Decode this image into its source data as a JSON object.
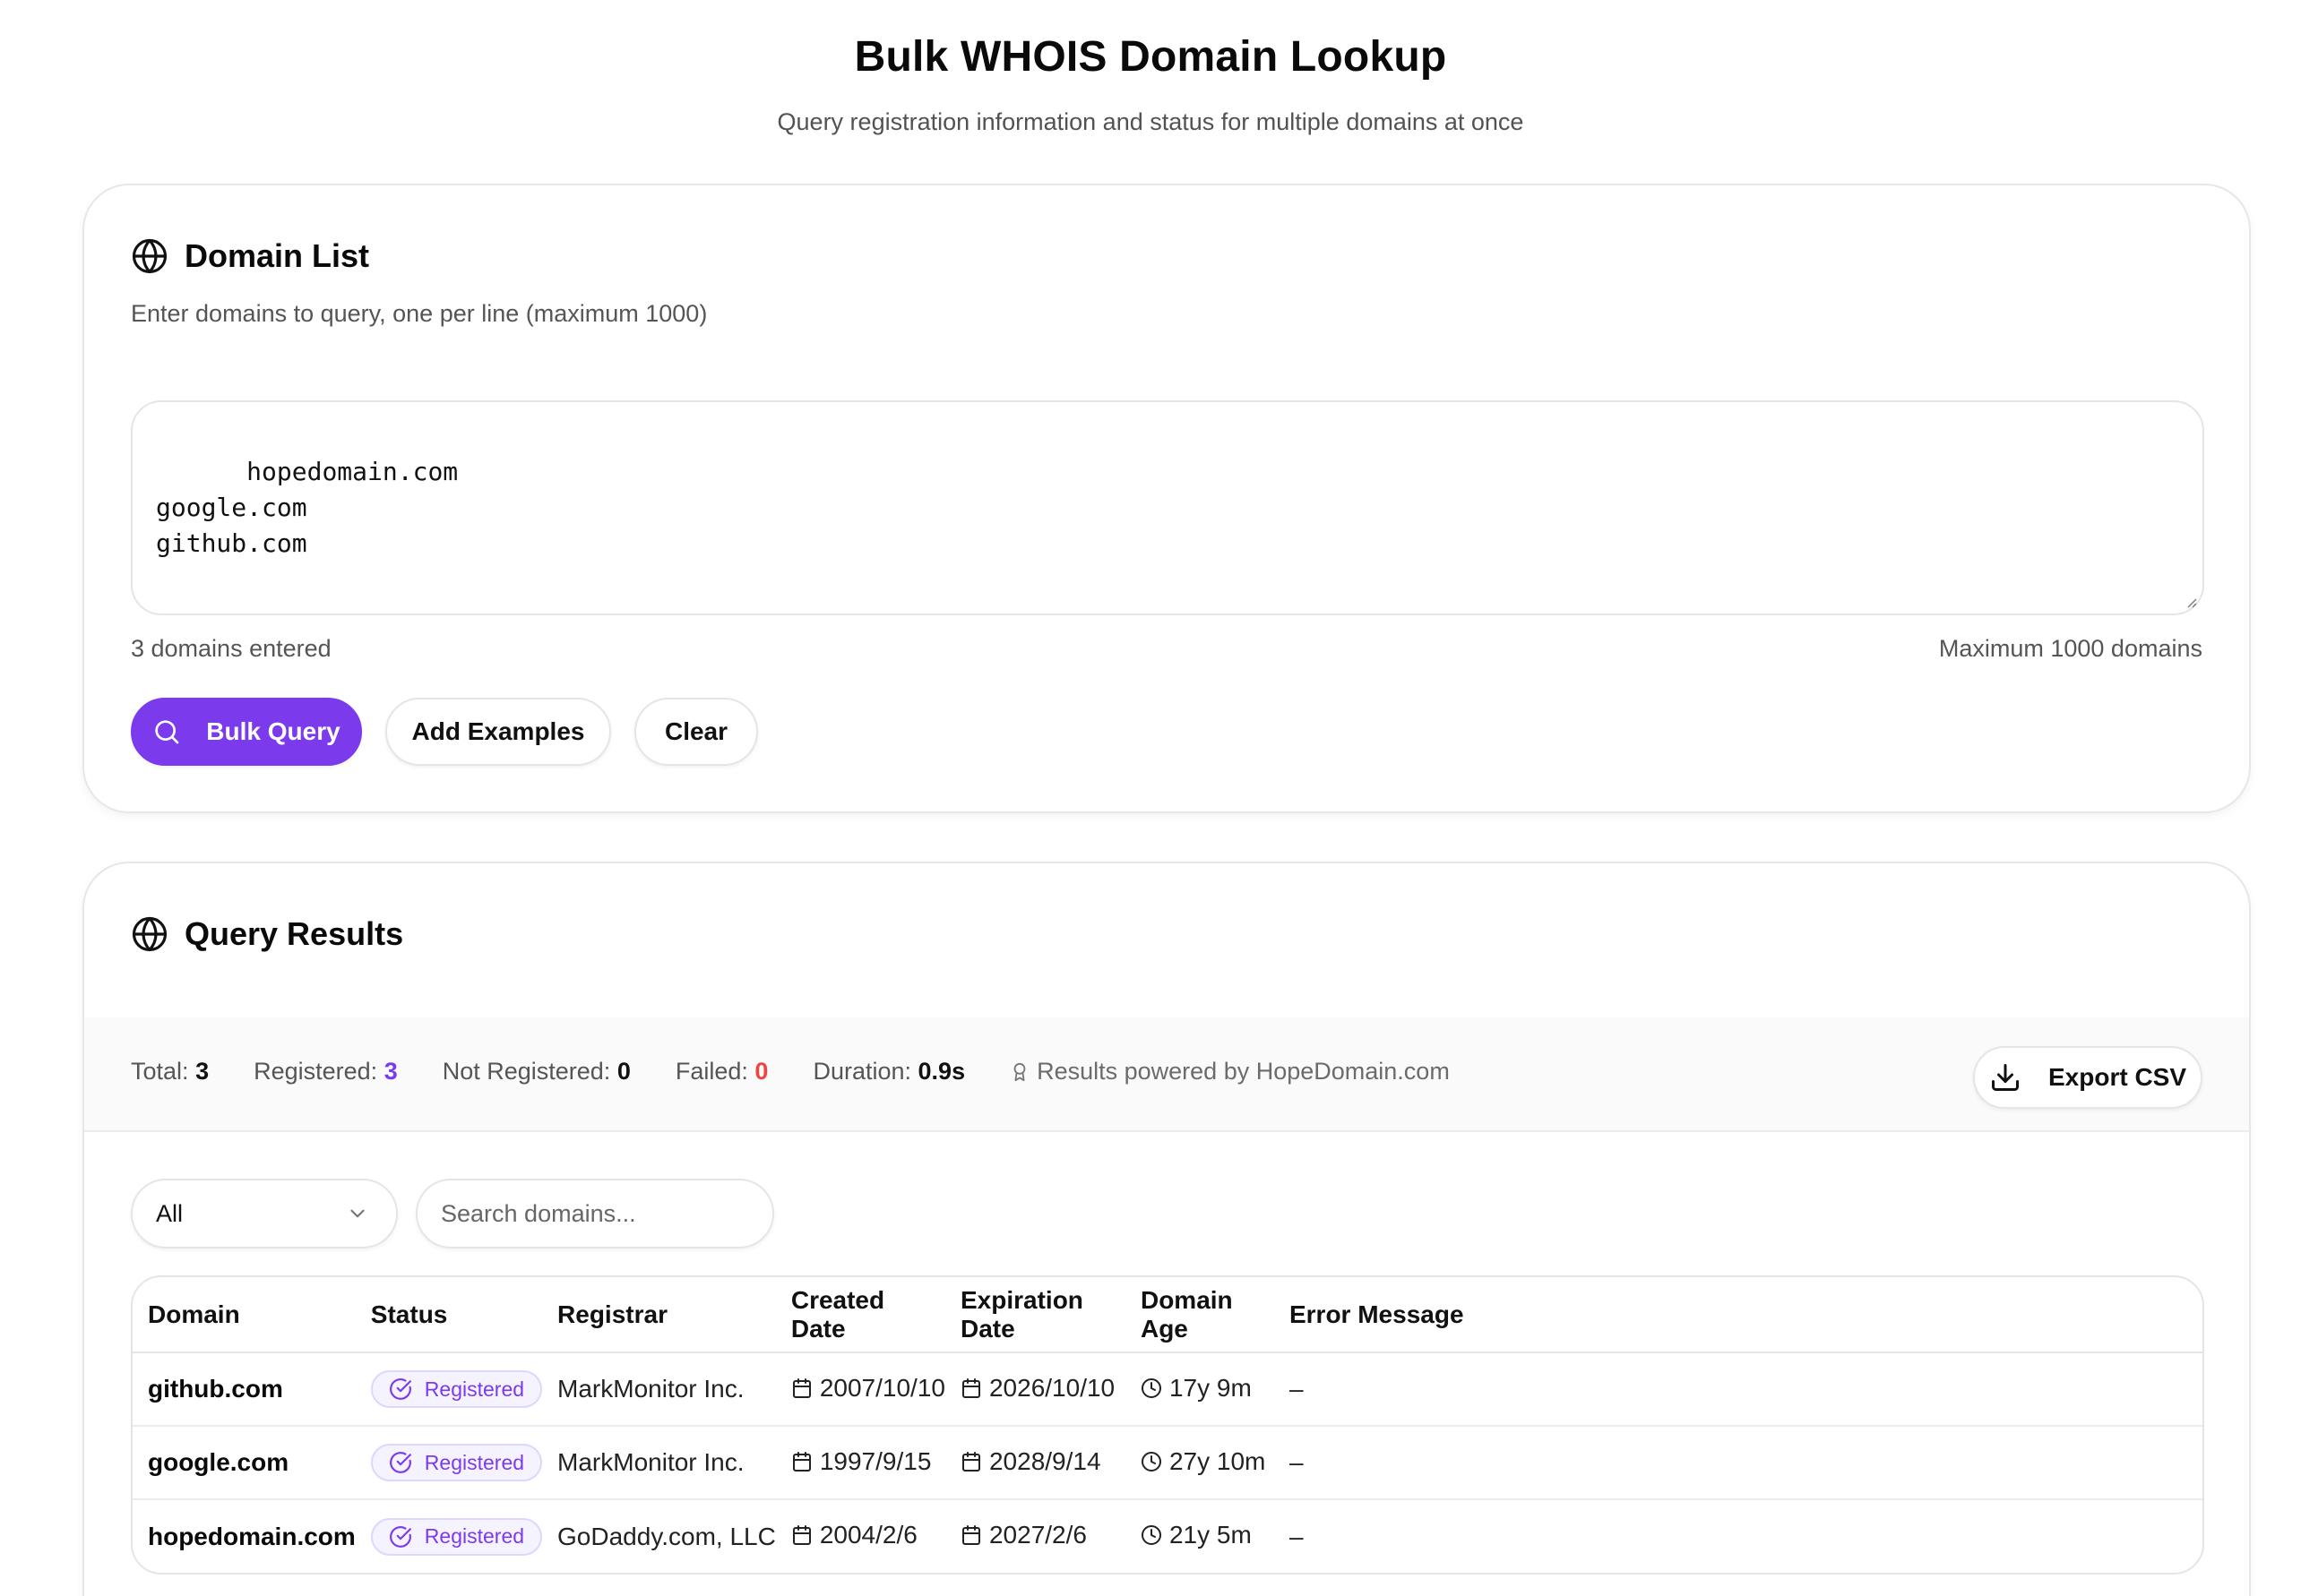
{
  "header": {
    "title": "Bulk WHOIS Domain Lookup",
    "subtitle": "Query registration information and status for multiple domains at once"
  },
  "domain_list": {
    "title": "Domain List",
    "title_icon": "globe-icon",
    "description": "Enter domains to query, one per line (maximum 1000)",
    "textarea_value": "hopedomain.com\ngoogle.com\ngithub.com",
    "count_text": "3 domains entered",
    "max_text": "Maximum 1000 domains",
    "buttons": {
      "bulk_query": "Bulk Query",
      "add_examples": "Add Examples",
      "clear": "Clear"
    }
  },
  "results": {
    "title": "Query Results",
    "title_icon": "globe-icon",
    "stats": {
      "total_label": "Total:",
      "total_value": "3",
      "registered_label": "Registered:",
      "registered_value": "3",
      "not_registered_label": "Not Registered:",
      "not_registered_value": "0",
      "failed_label": "Failed:",
      "failed_value": "0",
      "duration_label": "Duration:",
      "duration_value": "0.9s",
      "powered_by": "Results powered by HopeDomain.com"
    },
    "export_label": "Export CSV",
    "filter": {
      "selected": "All",
      "search_placeholder": "Search domains..."
    },
    "columns": [
      "Domain",
      "Status",
      "Registrar",
      "Created Date",
      "Expiration Date",
      "Domain Age",
      "Error Message"
    ],
    "rows": [
      {
        "domain": "github.com",
        "status": "Registered",
        "registrar": "MarkMonitor Inc.",
        "created": "2007/10/10",
        "expires": "2026/10/10",
        "age": "17y 9m",
        "error": "–"
      },
      {
        "domain": "google.com",
        "status": "Registered",
        "registrar": "MarkMonitor Inc.",
        "created": "1997/9/15",
        "expires": "2028/9/14",
        "age": "27y 10m",
        "error": "–"
      },
      {
        "domain": "hopedomain.com",
        "status": "Registered",
        "registrar": "GoDaddy.com, LLC",
        "created": "2004/2/6",
        "expires": "2027/2/6",
        "age": "21y 5m",
        "error": "–"
      }
    ]
  },
  "colors": {
    "accent": "#7c3aed",
    "danger": "#ef4444"
  }
}
